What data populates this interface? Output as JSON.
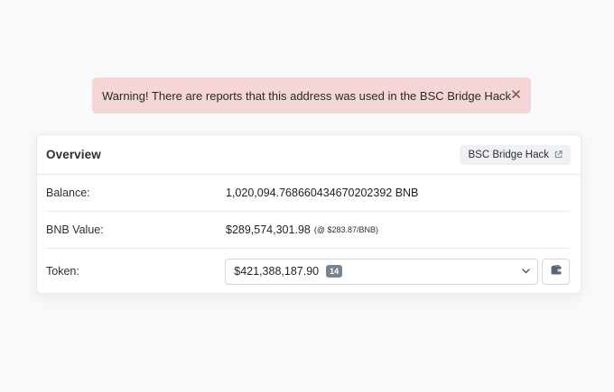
{
  "alert": {
    "text": "Warning! There are reports that this address was used in the BSC Bridge Hack",
    "close_icon": "close-icon"
  },
  "overview": {
    "title": "Overview",
    "tag_label": "BSC Bridge Hack",
    "tag_icon": "external-link-icon",
    "rows": {
      "balance": {
        "label": "Balance:",
        "value": "1,020,094.768660434670202392 BNB"
      },
      "bnb_value": {
        "label": "BNB Value:",
        "value": "$289,574,301.98",
        "price_note": "(@ $283.87/BNB)"
      },
      "token": {
        "label": "Token:",
        "amount": "$421,388,187.90",
        "count": "14",
        "dropdown_icon": "chevron-down-icon",
        "wallet_icon": "wallet-icon"
      }
    }
  },
  "colors": {
    "page_background": "#f8f9fa",
    "alert_background": "#f4d6d6",
    "border": "#e7eaf3",
    "badge": "#77838f"
  }
}
